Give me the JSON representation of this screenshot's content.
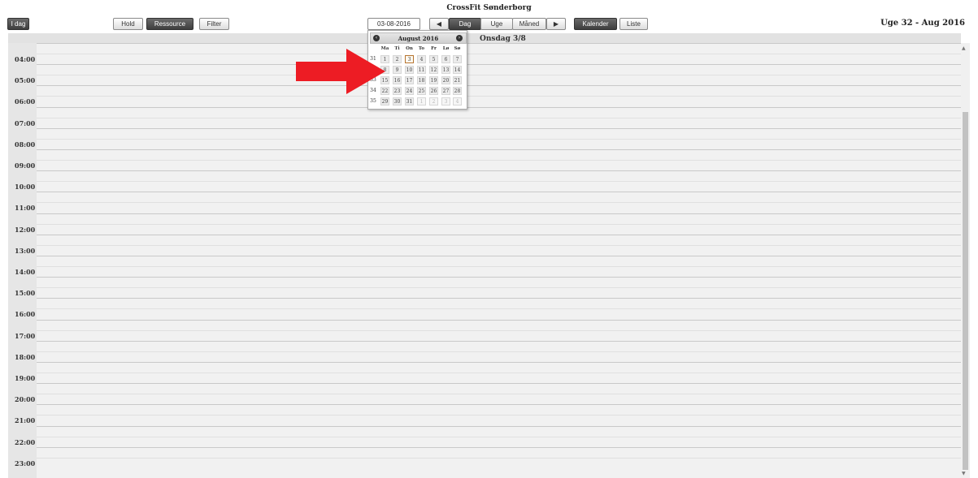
{
  "header": {
    "title": "CrossFit Sønderborg",
    "week_label": "Uge 32 - Aug 2016",
    "today_button": "I dag",
    "hold_button": "Hold",
    "ressource_button": "Ressource",
    "filter_button": "Filter",
    "date_field": "03-08-2016",
    "view_tabs": {
      "day": "Dag",
      "week": "Uge",
      "month": "Måned"
    },
    "kalender_button": "Kalender",
    "liste_button": "Liste"
  },
  "day_column": {
    "label": "Onsdag 3/8"
  },
  "times": [
    "04:00",
    "05:00",
    "06:00",
    "07:00",
    "08:00",
    "09:00",
    "10:00",
    "11:00",
    "12:00",
    "13:00",
    "14:00",
    "15:00",
    "16:00",
    "17:00",
    "18:00",
    "19:00",
    "20:00",
    "21:00",
    "22:00",
    "23:00"
  ],
  "datepicker": {
    "month_label": "August 2016",
    "weekdays": [
      "Ma",
      "Ti",
      "On",
      "To",
      "Fr",
      "Lø",
      "Sø"
    ],
    "weeks": [
      {
        "week": "31",
        "days": [
          "1",
          "2",
          "3",
          "4",
          "5",
          "6",
          "7"
        ]
      },
      {
        "week": "32",
        "days": [
          "8",
          "9",
          "10",
          "11",
          "12",
          "13",
          "14"
        ]
      },
      {
        "week": "33",
        "days": [
          "15",
          "16",
          "17",
          "18",
          "19",
          "20",
          "21"
        ]
      },
      {
        "week": "34",
        "days": [
          "22",
          "23",
          "24",
          "25",
          "26",
          "27",
          "28"
        ]
      },
      {
        "week": "35",
        "days": [
          "29",
          "30",
          "31",
          "1",
          "2",
          "3",
          "4"
        ]
      }
    ],
    "selected_day": "3"
  },
  "colors": {
    "accent_dark": "#4a4a4a",
    "annotation_arrow": "#ed1c24",
    "today_border": "#b6742f"
  }
}
